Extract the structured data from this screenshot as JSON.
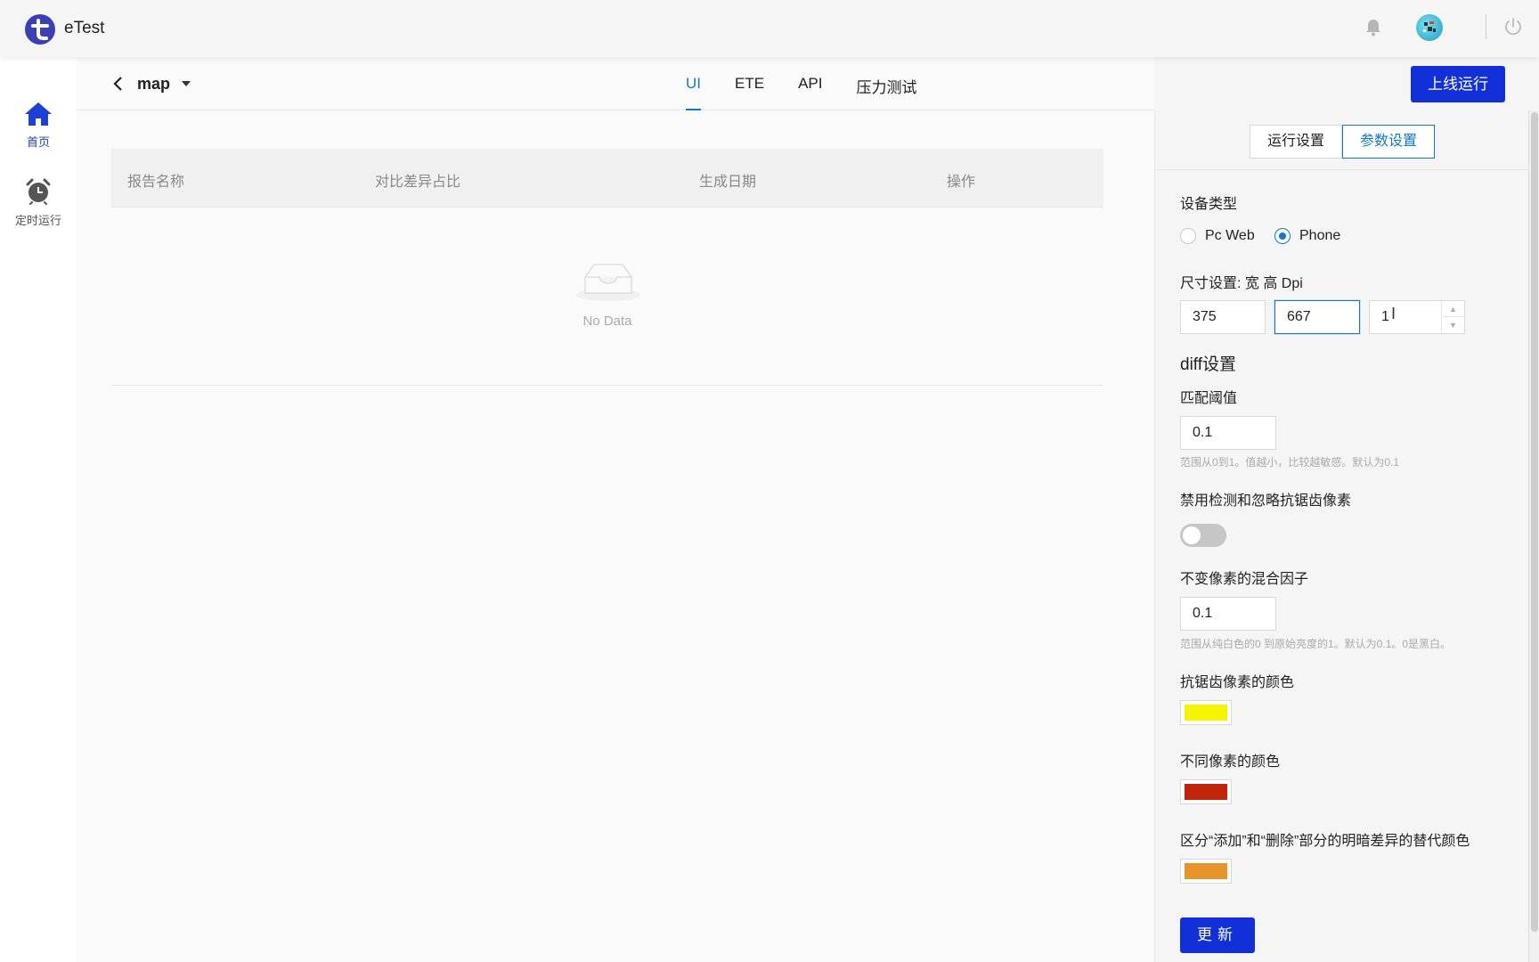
{
  "app": {
    "name": "eTest",
    "icons": {
      "logo": "etest-logo",
      "bell": "bell-icon",
      "avatar": "avatar",
      "power": "power-icon"
    }
  },
  "sidenav": {
    "items": [
      {
        "label": "首页",
        "icon": "home-icon",
        "active": true
      },
      {
        "label": "定时运行",
        "icon": "alarm-clock-icon",
        "active": false
      }
    ]
  },
  "header": {
    "project": "map",
    "tabs": [
      {
        "label": "UI",
        "active": true
      },
      {
        "label": "ETE"
      },
      {
        "label": "API"
      },
      {
        "label": "压力测试"
      }
    ],
    "deploy_label": "上线运行"
  },
  "table": {
    "columns": [
      "报告名称",
      "对比差异占比",
      "生成日期",
      "操作"
    ],
    "empty_text": "No Data"
  },
  "panel": {
    "segments": [
      {
        "label": "运行设置"
      },
      {
        "label": "参数设置",
        "active": true
      }
    ],
    "device_type_label": "设备类型",
    "device_options": [
      {
        "label": "Pc Web",
        "checked": false
      },
      {
        "label": "Phone",
        "checked": true
      }
    ],
    "size_label": "尺寸设置: 宽 高 Dpi",
    "width": "375",
    "height": "667",
    "dpi": "1",
    "diff_title": "diff设置",
    "threshold_label": "匹配阈值",
    "threshold_value": "0.1",
    "threshold_help": "范围从0到1。值越小，比较越敏感。默认为0.1",
    "aa_label": "禁用检测和忽略抗锯齿像素",
    "aa_enabled": false,
    "alpha_label": "不变像素的混合因子",
    "alpha_value": "0.1",
    "alpha_help": "范围从纯白色的0 到原始亮度的1。默认为0.1。0是黑白。",
    "aa_color_label": "抗锯齿像素的颜色",
    "aa_color": "#f7f400",
    "diff_color_label": "不同像素的颜色",
    "diff_color": "#c0250c",
    "alt_color_label": "区分“添加”和“删除”部分的明暗差异的替代颜色",
    "alt_color": "#e8942c",
    "update_label": "更新"
  },
  "colors": {
    "primary": "#1130d8",
    "accent": "#1677c8"
  }
}
